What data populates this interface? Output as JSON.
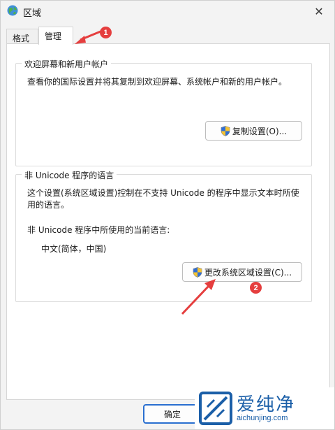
{
  "window": {
    "title": "区域",
    "close_glyph": "✕"
  },
  "tabs": [
    {
      "label": "格式"
    },
    {
      "label": "管理"
    }
  ],
  "welcome_group": {
    "title": "欢迎屏幕和新用户帐户",
    "description": "查看你的国际设置并将其复制到欢迎屏幕、系统帐户和新的用户帐户。",
    "copy_button": "复制设置(O)..."
  },
  "unicode_group": {
    "title": "非 Unicode 程序的语言",
    "description_line1": "这个设置(系统区域设置)控制在不支持 Unicode 的程序中显示文本时所使",
    "description_line2": "用的语言。",
    "current_label": "非 Unicode 程序中所使用的当前语言:",
    "current_value": "中文(简体，中国)",
    "change_button": "更改系统区域设置(C)..."
  },
  "footer": {
    "ok_label": "确定"
  },
  "annotations": {
    "badge1": "1",
    "badge2": "2",
    "color": "#e53e3e"
  },
  "watermark": {
    "brand": "爱纯净",
    "domain": "aichunjing.com",
    "color": "#1b5fa8"
  }
}
